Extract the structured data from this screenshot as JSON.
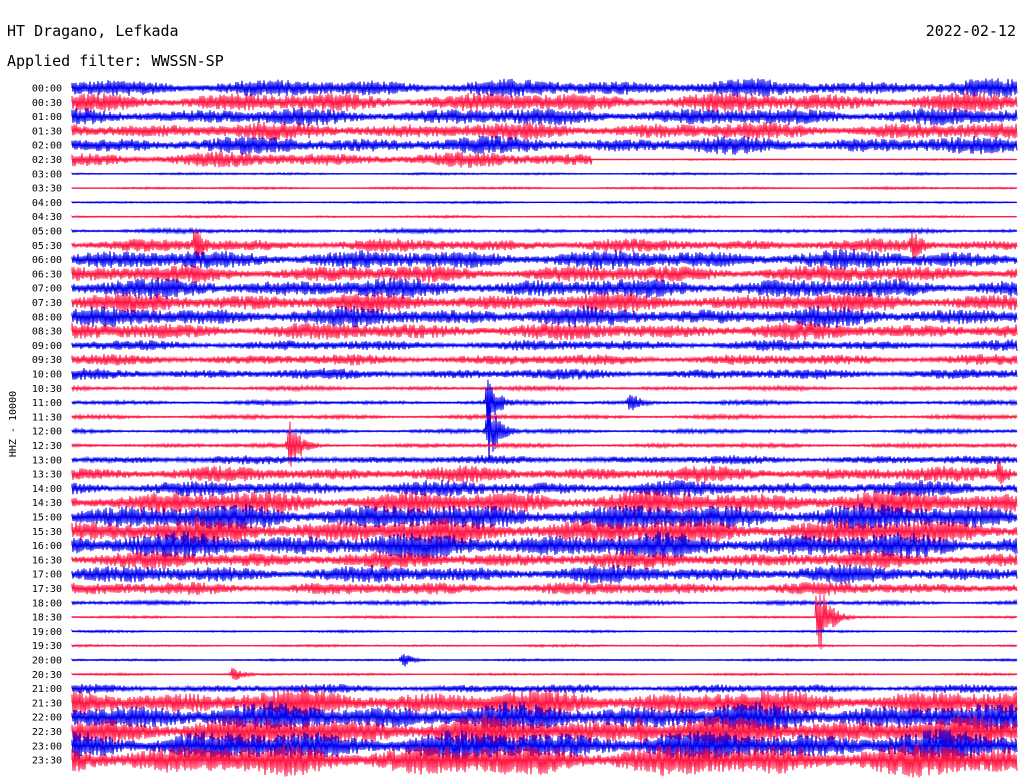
{
  "header": {
    "station": "HT Dragano, Lefkada",
    "date": "2022-02-12",
    "filter": "Applied filter: WWSSN-SP"
  },
  "chart_data": {
    "type": "helicorder",
    "title": "HT Dragano, Lefkada",
    "date": "2022-02-12",
    "filter": "WWSSN-SP",
    "channel_label": "HHZ - 10000",
    "colors": {
      "even_line": "#0000ee",
      "odd_line": "#ff1744"
    },
    "row_times": [
      "00:00",
      "00:30",
      "01:00",
      "01:30",
      "02:00",
      "02:30",
      "03:00",
      "03:30",
      "04:00",
      "04:30",
      "05:00",
      "05:30",
      "06:00",
      "06:30",
      "07:00",
      "07:30",
      "08:00",
      "08:30",
      "09:00",
      "09:30",
      "10:00",
      "10:30",
      "11:00",
      "11:30",
      "12:00",
      "12:30",
      "13:00",
      "13:30",
      "14:00",
      "14:30",
      "15:00",
      "15:30",
      "16:00",
      "16:30",
      "17:00",
      "17:30",
      "18:00",
      "18:30",
      "19:00",
      "19:30",
      "20:00",
      "20:30",
      "21:00",
      "21:30",
      "22:00",
      "22:30",
      "23:00",
      "23:30"
    ],
    "noise_level": [
      8,
      9,
      8,
      8,
      8,
      7,
      1,
      1,
      1,
      1,
      2,
      6,
      9,
      8,
      9,
      9,
      9,
      8,
      5,
      5,
      5,
      2,
      2,
      2,
      2,
      2,
      4,
      7,
      7,
      11,
      12,
      12,
      12,
      8,
      8,
      6,
      2,
      1,
      1,
      1,
      1,
      1,
      4,
      12,
      13,
      14,
      14,
      15
    ],
    "events": [
      {
        "time": "02:30",
        "end_fraction": 0.55,
        "note": "noise stops"
      },
      {
        "time": "03:00",
        "start_fraction": 0.0,
        "note": "quiet"
      },
      {
        "time": "05:30",
        "fraction": 0.13,
        "amplitude": 20
      },
      {
        "time": "05:30",
        "fraction": 0.89,
        "amplitude": 18
      },
      {
        "time": "11:00",
        "fraction": 0.44,
        "amplitude": 26
      },
      {
        "time": "12:00",
        "fraction": 0.44,
        "amplitude": 34
      },
      {
        "time": "12:30",
        "fraction": 0.23,
        "amplitude": 28
      },
      {
        "time": "11:00",
        "fraction": 0.59,
        "amplitude": 12
      },
      {
        "time": "18:30",
        "fraction": 0.79,
        "amplitude": 40
      },
      {
        "time": "20:00",
        "fraction": 0.35,
        "amplitude": 8
      },
      {
        "time": "20:30",
        "fraction": 0.17,
        "amplitude": 8
      },
      {
        "time": "15:30",
        "fraction": 0.41,
        "amplitude": 16
      },
      {
        "time": "13:30",
        "fraction": 0.98,
        "amplitude": 16
      },
      {
        "time": "22:30",
        "fraction": 0.6,
        "amplitude": 20
      }
    ]
  }
}
